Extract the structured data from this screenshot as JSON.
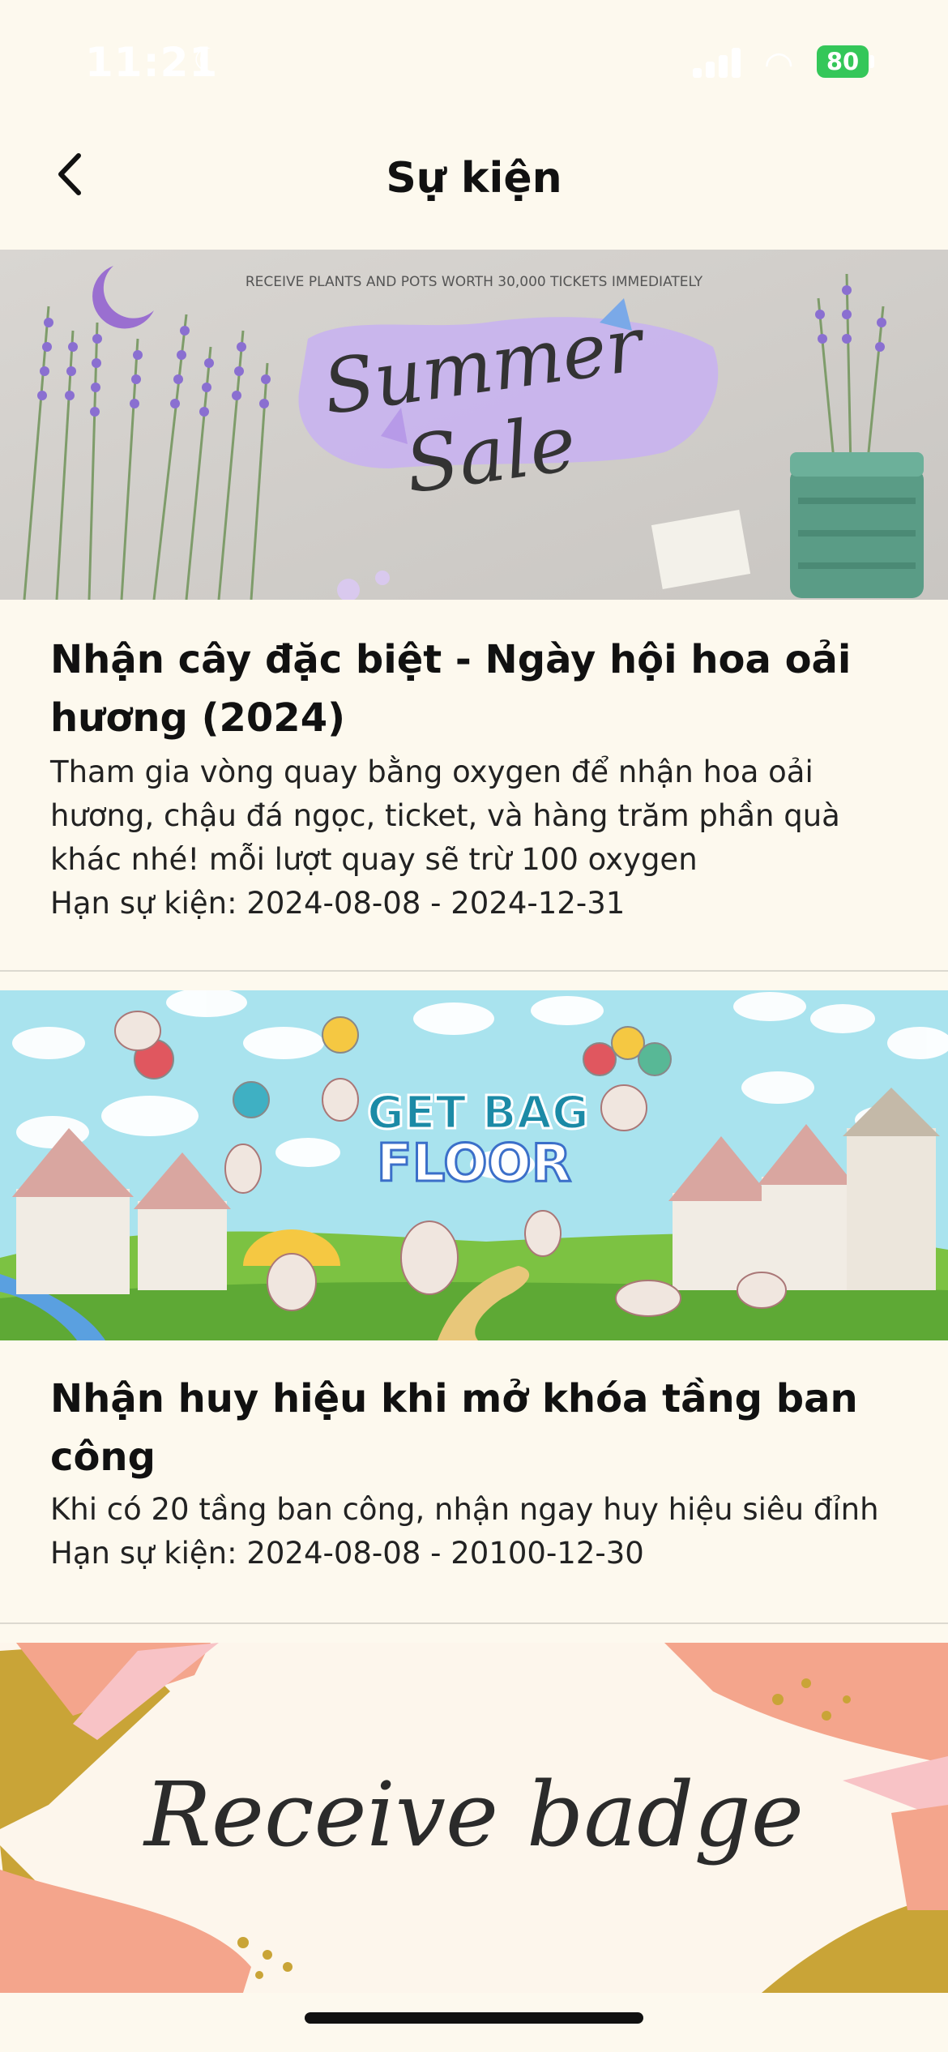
{
  "status_bar": {
    "time": "11:21",
    "battery": "80"
  },
  "header": {
    "title": "Sự kiện"
  },
  "events": [
    {
      "banner_text": "RECEIVE PLANTS AND POTS WORTH 30,000 TICKETS IMMEDIATELY",
      "banner_script_1": "Summer",
      "banner_script_2": "Sale",
      "title": "Nhận cây đặc biệt - Ngày hội hoa oải hương (2024)",
      "description": "Tham gia vòng quay bằng oxygen để nhận hoa oải hương, chậu đá ngọc, ticket, và hàng trăm phần quà khác nhé! mỗi lượt quay sẽ trừ 100 oxygen",
      "date": "Hạn sự kiện: 2024-08-08 - 2024-12-31"
    },
    {
      "banner_text_1": "GET BAG",
      "banner_text_2": "FLOOR",
      "title": "Nhận huy hiệu khi mở khóa tầng ban công",
      "description": "Khi có 20 tầng ban công, nhận ngay huy hiệu siêu đỉnh",
      "date": "Hạn sự kiện: 2024-08-08 - 20100-12-30"
    },
    {
      "banner_text": "Receive badge"
    }
  ],
  "colors": {
    "background": "#fdf9ee",
    "lavender": "#8a6fd1",
    "sky": "#a9e3ee",
    "grass": "#7cc242",
    "peach": "#f4a58c",
    "gold": "#c9a437"
  },
  "icons": {
    "back": "chevron-left-icon",
    "signal": "signal-icon",
    "wifi": "wifi-icon",
    "battery": "battery-icon"
  }
}
